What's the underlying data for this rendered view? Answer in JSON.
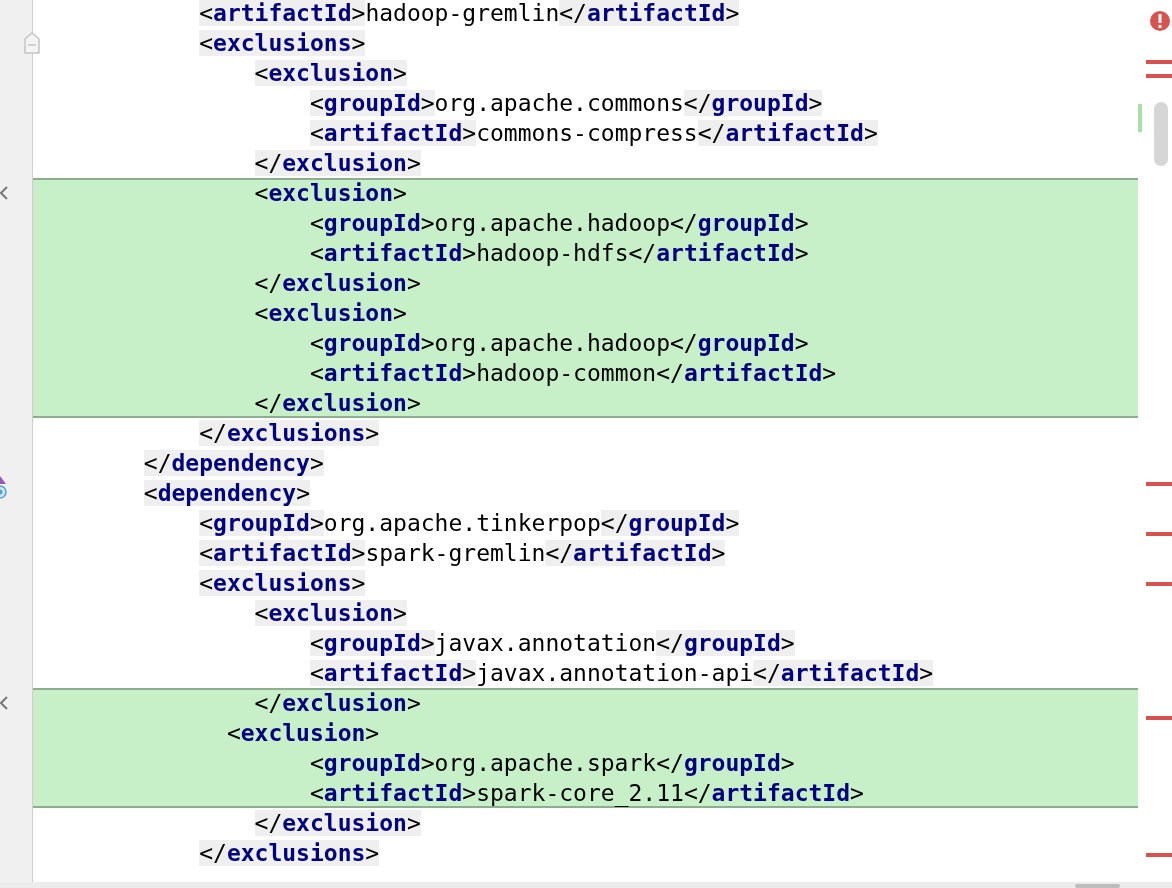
{
  "editor": {
    "lines": [
      {
        "kind": "plain",
        "code": "            <artifactId>hadoop-gremlin</artifactId>",
        "changed": false
      },
      {
        "kind": "fold",
        "code": "            <exclusions>",
        "changed": false
      },
      {
        "kind": "plain",
        "code": "                <exclusion>",
        "changed": false
      },
      {
        "kind": "plain",
        "code": "                    <groupId>org.apache.commons</groupId>",
        "changed": false
      },
      {
        "kind": "plain",
        "code": "                    <artifactId>commons-compress</artifactId>",
        "changed": false
      },
      {
        "kind": "plain",
        "code": "                </exclusion>",
        "changed": false
      },
      {
        "kind": "plain",
        "code": "                <exclusion>",
        "changed": true
      },
      {
        "kind": "plain",
        "code": "                    <groupId>org.apache.hadoop</groupId>",
        "changed": true
      },
      {
        "kind": "plain",
        "code": "                    <artifactId>hadoop-hdfs</artifactId>",
        "changed": true
      },
      {
        "kind": "plain",
        "code": "                </exclusion>",
        "changed": true
      },
      {
        "kind": "plain",
        "code": "                <exclusion>",
        "changed": true
      },
      {
        "kind": "plain",
        "code": "                    <groupId>org.apache.hadoop</groupId>",
        "changed": true
      },
      {
        "kind": "plain",
        "code": "                    <artifactId>hadoop-common</artifactId>",
        "changed": true
      },
      {
        "kind": "plain",
        "code": "                </exclusion>",
        "changed": true
      },
      {
        "kind": "plain",
        "code": "            </exclusions>",
        "changed": false
      },
      {
        "kind": "plain",
        "code": "        </dependency>",
        "changed": false
      },
      {
        "kind": "marker",
        "code": "        <dependency>",
        "changed": false
      },
      {
        "kind": "plain",
        "code": "            <groupId>org.apache.tinkerpop</groupId>",
        "changed": false
      },
      {
        "kind": "plain",
        "code": "            <artifactId>spark-gremlin</artifactId>",
        "changed": false
      },
      {
        "kind": "plain",
        "code": "            <exclusions>",
        "changed": false
      },
      {
        "kind": "plain",
        "code": "                <exclusion>",
        "changed": false
      },
      {
        "kind": "plain",
        "code": "                    <groupId>javax.annotation</groupId>",
        "changed": false
      },
      {
        "kind": "plain",
        "code": "                    <artifactId>javax.annotation-api</artifactId>",
        "changed": false
      },
      {
        "kind": "plain",
        "code": "                </exclusion>",
        "changed": true
      },
      {
        "kind": "plain",
        "code": "              <exclusion>",
        "changed": true
      },
      {
        "kind": "plain",
        "code": "                    <groupId>org.apache.spark</groupId>",
        "changed": true
      },
      {
        "kind": "plain",
        "code": "                    <artifactId>spark-core_2.11</artifactId>",
        "changed": true
      },
      {
        "kind": "plain",
        "code": "                </exclusion>",
        "changed": false
      },
      {
        "kind": "plain",
        "code": "            </exclusions>",
        "changed": false
      }
    ]
  }
}
